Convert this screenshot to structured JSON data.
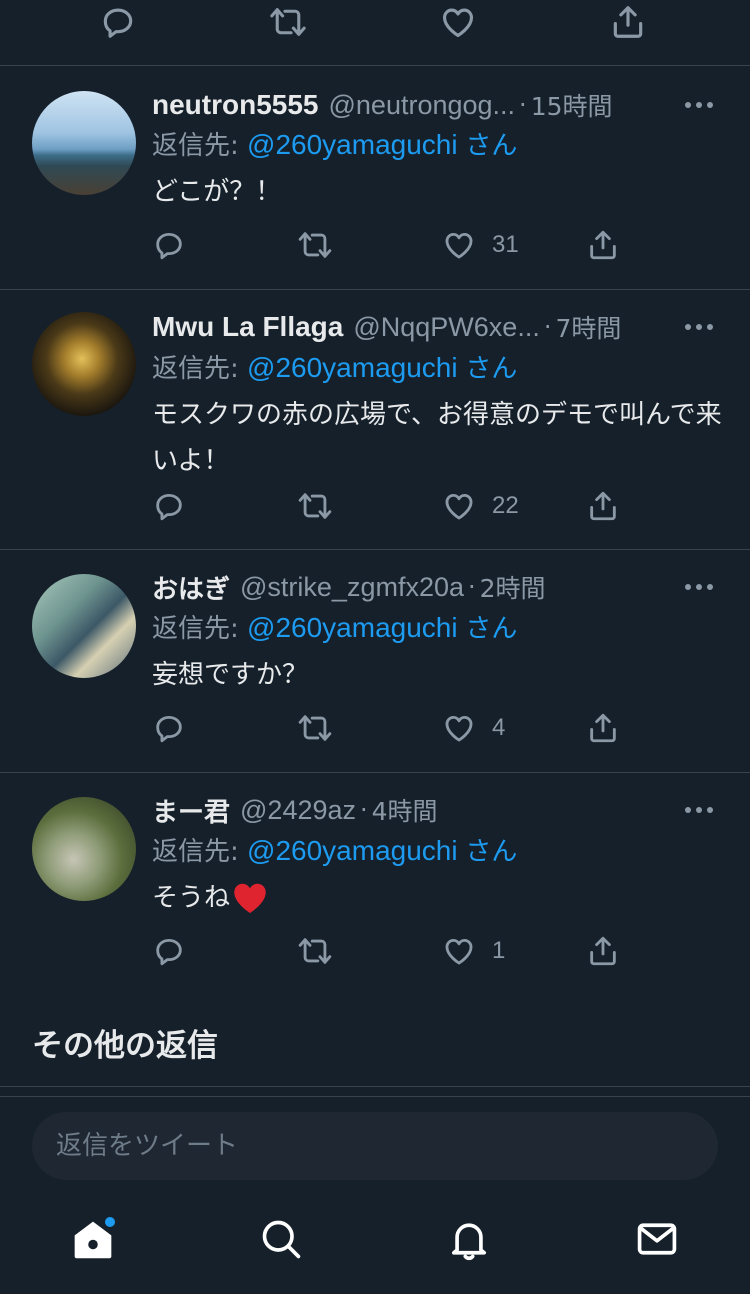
{
  "tweets": [
    {
      "name": "neutron5555",
      "handle": "@neutrongog...",
      "time": "15時間",
      "reply_prefix": "返信先: ",
      "reply_to": "@260yamaguchi",
      "reply_suffix": "さん",
      "text": "どこが？！",
      "likes": "31",
      "avatar_colors": [
        "#b9d6ee",
        "#6f9ec2",
        "#3c6a86",
        "#4a4034"
      ]
    },
    {
      "name": "Mwu La Fllaga",
      "handle": "@NqqPW6xe...",
      "time": "7時間",
      "reply_prefix": "返信先: ",
      "reply_to": "@260yamaguchi",
      "reply_suffix": "さん",
      "text": "モスクワの赤の広場で、お得意のデモで叫んで来いよ！",
      "likes": "22",
      "avatar_colors": [
        "#14110e",
        "#6b5320",
        "#c9a44a",
        "#3a2f1a"
      ]
    },
    {
      "name": "おはぎ",
      "handle": "@strike_zgmfx20a",
      "time": "2時間",
      "reply_prefix": "返信先: ",
      "reply_to": "@260yamaguchi",
      "reply_suffix": "さん",
      "text": "妄想ですか？",
      "likes": "4",
      "avatar_colors": [
        "#8fb4a8",
        "#3f5f6b",
        "#d8d3b6",
        "#2e3a45"
      ]
    },
    {
      "name": "まー君",
      "handle": "@2429az",
      "time": "4時間",
      "reply_prefix": "返信先: ",
      "reply_to": "@260yamaguchi",
      "reply_suffix": "さん",
      "text": "そうね",
      "emoji": "❤️",
      "likes": "1",
      "avatar_colors": [
        "#9aa88a",
        "#586b3c",
        "#c9c6b8",
        "#3b4a2a"
      ]
    }
  ],
  "section_heading": "その他の返信",
  "composer": {
    "placeholder": "返信をツイート"
  },
  "icons": {
    "reply": "reply-icon",
    "retweet": "retweet-icon",
    "like": "heart-icon",
    "share": "share-icon",
    "more": "more-icon"
  },
  "tabbar": [
    "home-icon",
    "search-icon",
    "notifications-icon",
    "messages-icon"
  ],
  "colors": {
    "background": "#15202b",
    "accent": "#1d9bf0",
    "muted": "#8b98a5",
    "divider": "#38444d"
  }
}
